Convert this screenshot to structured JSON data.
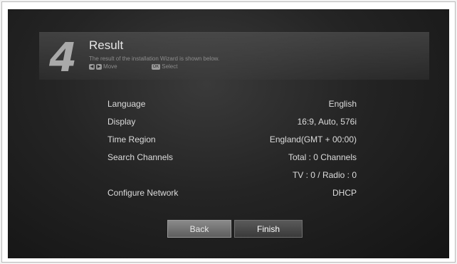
{
  "header": {
    "step": "4",
    "title": "Result",
    "subtitle": "The result of the installation Wizard is shown below.",
    "hints": {
      "move_label": "Move",
      "ok_key": "OK",
      "select_label": "Select"
    }
  },
  "results": [
    {
      "label": "Language",
      "value": "English"
    },
    {
      "label": "Display",
      "value": "16:9, Auto, 576i"
    },
    {
      "label": "Time Region",
      "value": "England(GMT + 00:00)"
    },
    {
      "label": "Search Channels",
      "value": "Total : 0 Channels"
    },
    {
      "label": "",
      "value": "TV : 0 / Radio : 0"
    },
    {
      "label": "Configure Network",
      "value": "DHCP"
    }
  ],
  "buttons": {
    "back": "Back",
    "finish": "Finish"
  }
}
